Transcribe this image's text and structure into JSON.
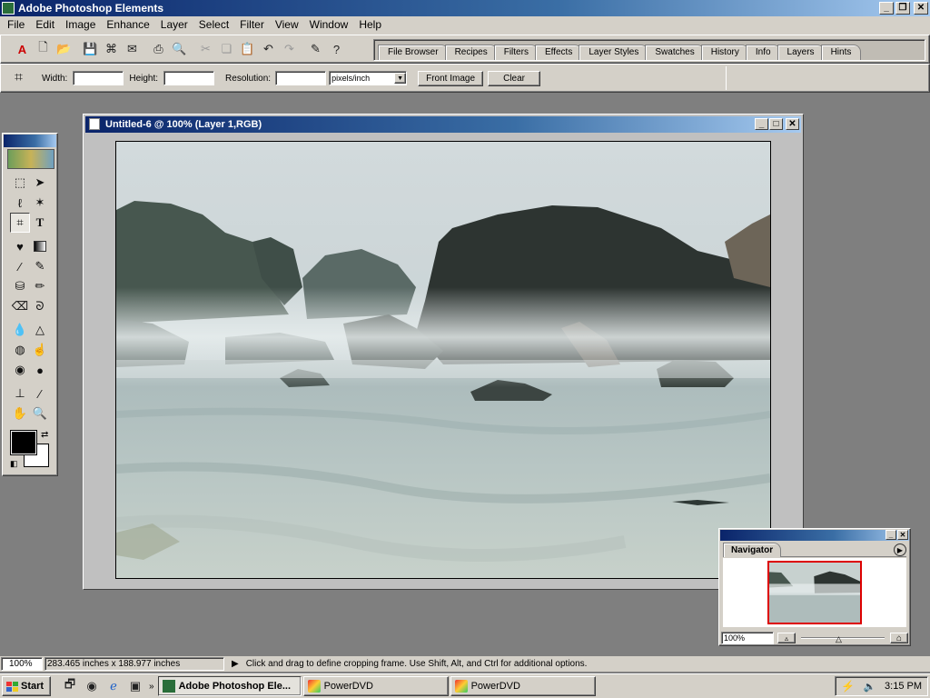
{
  "app": {
    "title": "Adobe Photoshop Elements"
  },
  "menu": [
    "File",
    "Edit",
    "Image",
    "Enhance",
    "Layer",
    "Select",
    "Filter",
    "View",
    "Window",
    "Help"
  ],
  "palette_tabs": [
    "File Browser",
    "Recipes",
    "Filters",
    "Effects",
    "Layer Styles",
    "Swatches",
    "History",
    "Info",
    "Layers",
    "Hints"
  ],
  "options": {
    "width_label": "Width:",
    "height_label": "Height:",
    "resolution_label": "Resolution:",
    "units_value": "pixels/inch",
    "front_image": "Front Image",
    "clear": "Clear"
  },
  "document": {
    "title": "Untitled-6 @ 100% (Layer 1,RGB)"
  },
  "navigator": {
    "title": "Navigator",
    "zoom": "100%"
  },
  "status": {
    "zoom": "100%",
    "size": "283.465 inches x 188.977 inches",
    "hint": "Click and drag to define cropping frame. Use Shift, Alt, and Ctrl for additional options."
  },
  "taskbar": {
    "start": "Start",
    "tasks": [
      "Adobe Photoshop Ele...",
      "PowerDVD",
      "PowerDVD"
    ],
    "clock": "3:15 PM"
  },
  "colors": {
    "title_active": "#0a246a",
    "face": "#d4d0c8",
    "desktop": "#7f7f7f"
  }
}
